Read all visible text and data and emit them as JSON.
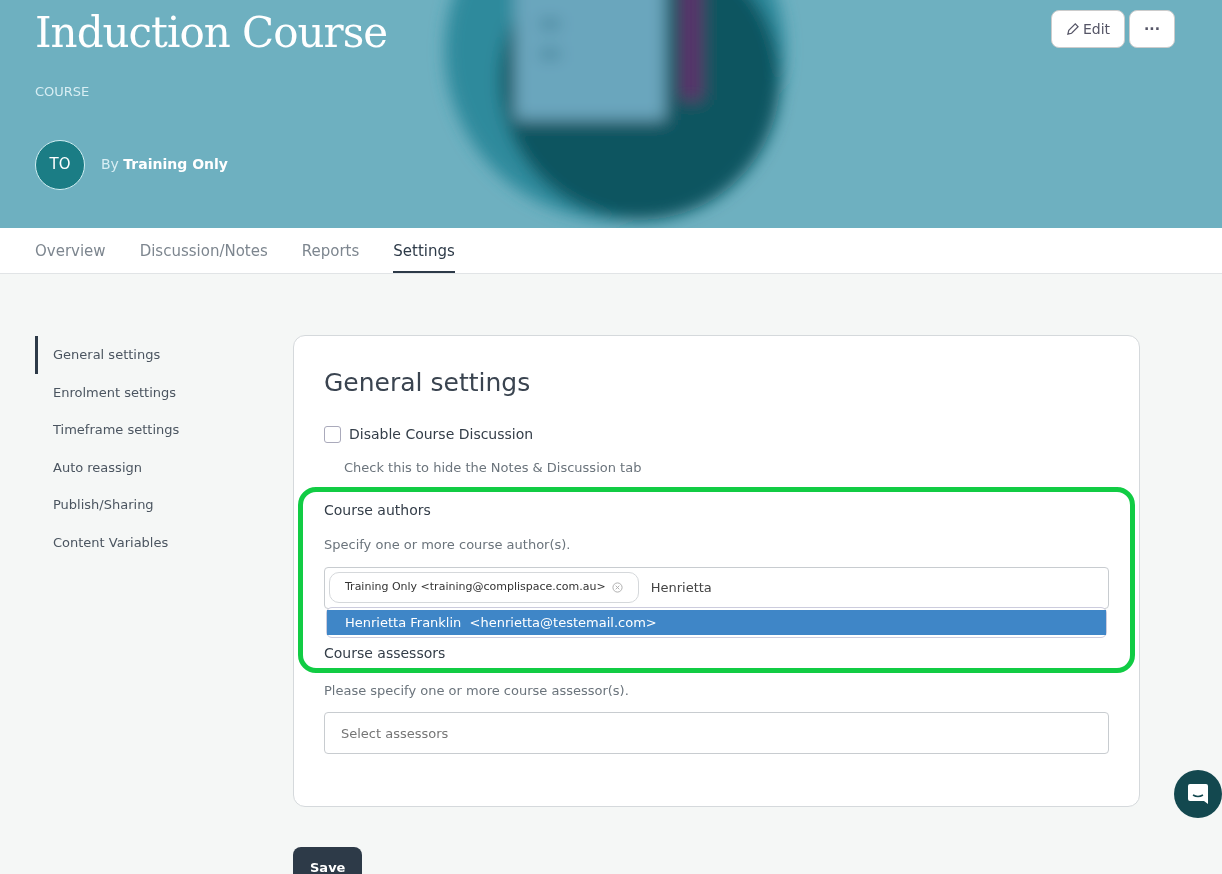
{
  "header": {
    "title": "Induction Course",
    "type_label": "COURSE",
    "author_initials": "TO",
    "by_label": "By",
    "author_name": "Training Only",
    "edit_button": "Edit",
    "more_button": "···"
  },
  "tabs": [
    {
      "label": "Overview",
      "selected": false
    },
    {
      "label": "Discussion/Notes",
      "selected": false
    },
    {
      "label": "Reports",
      "selected": false
    },
    {
      "label": "Settings",
      "selected": true
    }
  ],
  "sidebar": {
    "items": [
      {
        "label": "General settings",
        "selected": true
      },
      {
        "label": "Enrolment settings",
        "selected": false
      },
      {
        "label": "Timeframe settings",
        "selected": false
      },
      {
        "label": "Auto reassign",
        "selected": false
      },
      {
        "label": "Publish/Sharing",
        "selected": false
      },
      {
        "label": "Content Variables",
        "selected": false
      }
    ]
  },
  "panel": {
    "title": "General settings",
    "disable_discussion": {
      "label": "Disable Course Discussion",
      "checked": false,
      "help": "Check this to hide the Notes & Discussion tab"
    },
    "authors": {
      "label": "Course authors",
      "help": "Specify one or more course author(s).",
      "tags": [
        "Training Only <training@complispace.com.au>"
      ],
      "value": "Henrietta",
      "suggestions": [
        {
          "name": "Henrietta Franklin",
          "email": "<henrietta@testemail.com>",
          "selected": true
        }
      ]
    },
    "assessors": {
      "label": "Course assessors",
      "help": "Please specify one or more course assessor(s).",
      "placeholder": "Select assessors"
    }
  },
  "save_button": "Save"
}
